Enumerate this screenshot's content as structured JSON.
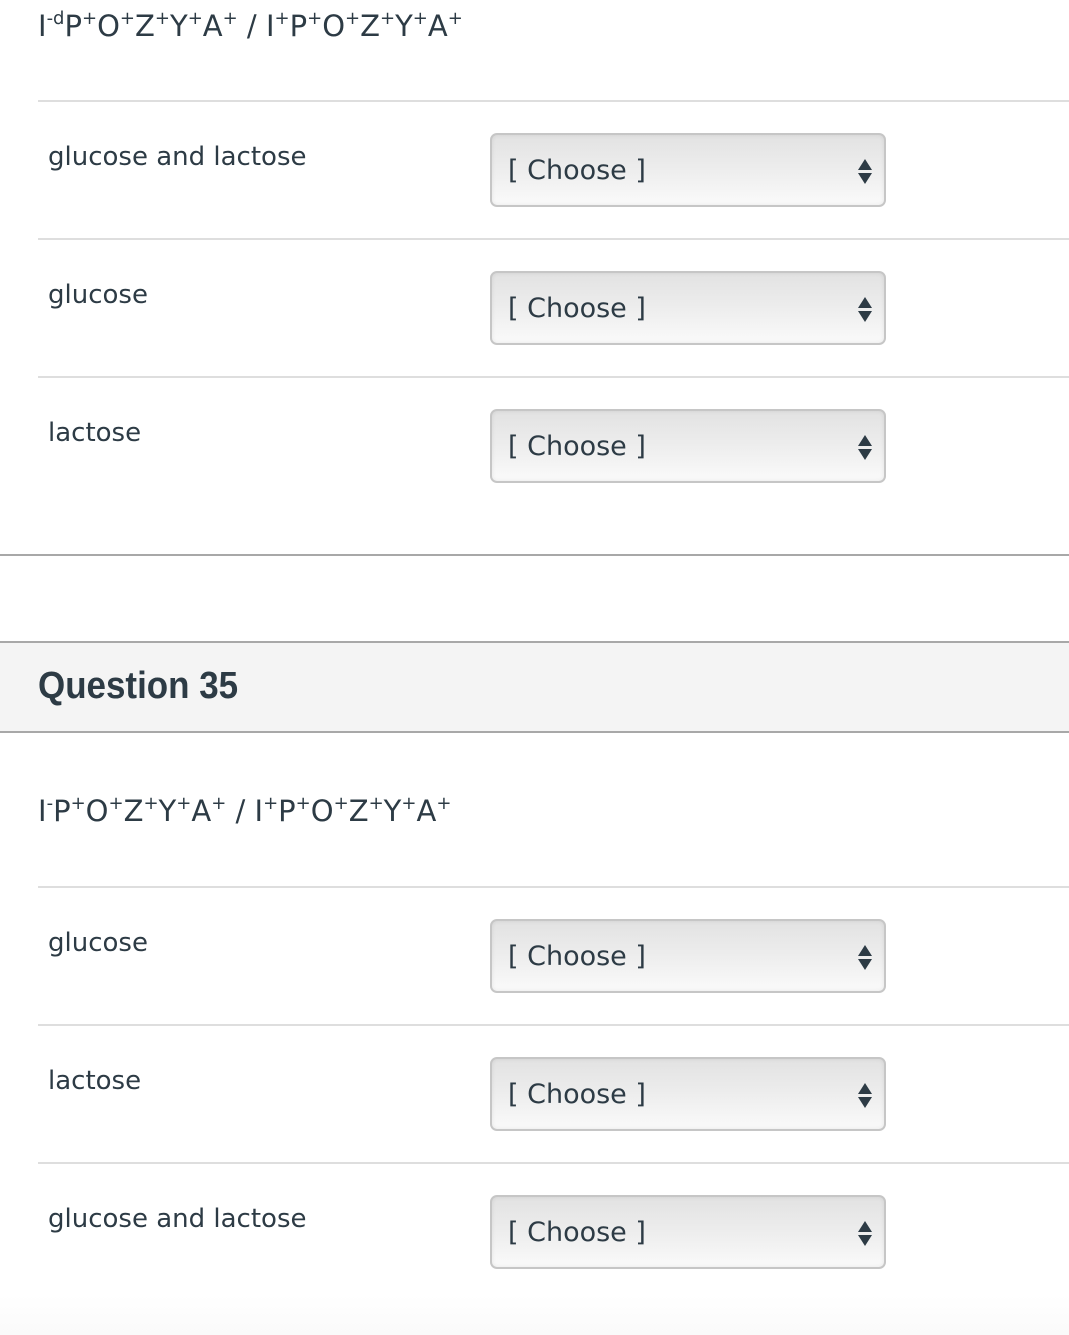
{
  "question_34": {
    "genotype": {
      "parts": [
        {
          "base": "I",
          "sup": "-d"
        },
        {
          "base": "P",
          "sup": "+"
        },
        {
          "base": "O",
          "sup": "+"
        },
        {
          "base": "Z",
          "sup": "+"
        },
        {
          "base": "Y",
          "sup": "+"
        },
        {
          "base": "A",
          "sup": "+"
        },
        {
          "base": " / ",
          "sup": ""
        },
        {
          "base": "I",
          "sup": "+"
        },
        {
          "base": "P",
          "sup": "+"
        },
        {
          "base": "O",
          "sup": "+"
        },
        {
          "base": "Z",
          "sup": "+"
        },
        {
          "base": "Y",
          "sup": "+"
        },
        {
          "base": "A",
          "sup": "+"
        }
      ]
    },
    "matches": [
      {
        "label": "glucose and lactose",
        "selected": "[ Choose ]"
      },
      {
        "label": "glucose",
        "selected": "[ Choose ]"
      },
      {
        "label": "lactose",
        "selected": "[ Choose ]"
      }
    ]
  },
  "question_35": {
    "title": "Question 35",
    "genotype": {
      "parts": [
        {
          "base": "I",
          "sup": "-"
        },
        {
          "base": "P",
          "sup": "+"
        },
        {
          "base": "O",
          "sup": "+"
        },
        {
          "base": "Z",
          "sup": "+"
        },
        {
          "base": "Y",
          "sup": "+"
        },
        {
          "base": "A",
          "sup": "+"
        },
        {
          "base": " / ",
          "sup": ""
        },
        {
          "base": "I",
          "sup": "+"
        },
        {
          "base": "P",
          "sup": "+"
        },
        {
          "base": "O",
          "sup": "+"
        },
        {
          "base": "Z",
          "sup": "+"
        },
        {
          "base": "Y",
          "sup": "+"
        },
        {
          "base": "A",
          "sup": "+"
        }
      ]
    },
    "matches": [
      {
        "label": "glucose",
        "selected": "[ Choose ]"
      },
      {
        "label": "lactose",
        "selected": "[ Choose ]"
      },
      {
        "label": "glucose and lactose",
        "selected": "[ Choose ]"
      }
    ]
  }
}
